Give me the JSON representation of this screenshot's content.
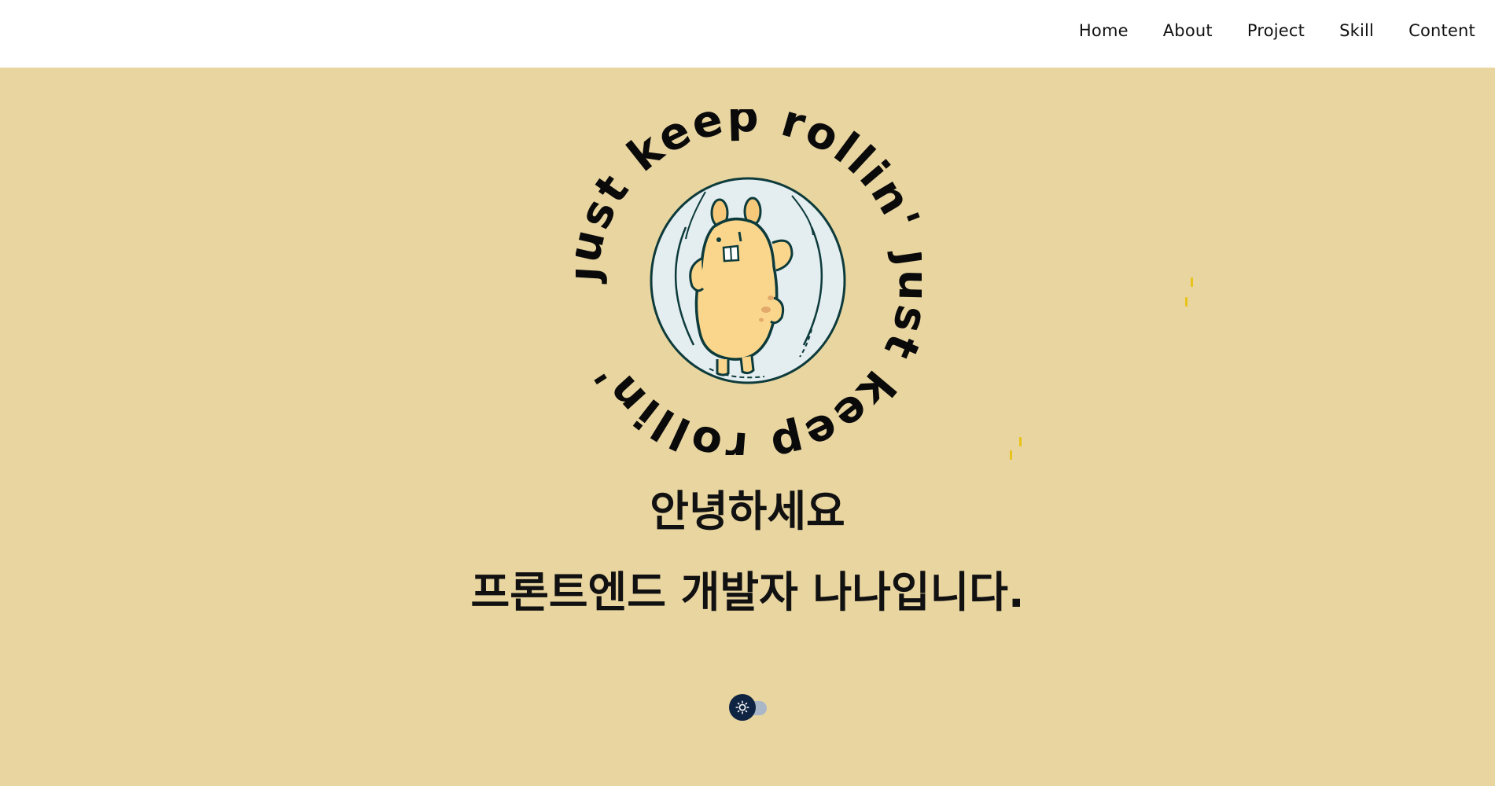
{
  "nav": {
    "items": [
      {
        "label": "Home"
      },
      {
        "label": "About"
      },
      {
        "label": "Project"
      },
      {
        "label": "Skill"
      },
      {
        "label": "Content"
      }
    ]
  },
  "hero": {
    "logo_ring_text": "just keep rollin' just keep rollin'",
    "greeting": "안녕하세요",
    "intro": "프론트엔드 개발자 나나입니다."
  },
  "theme_toggle": {
    "icon": "sun-icon",
    "state": "light"
  },
  "colors": {
    "header_bg": "#ffffff",
    "hero_bg": "#e8d5a0",
    "text": "#111111",
    "toggle_knob": "#0f2342",
    "toggle_track": "#a9b7c9",
    "sparkle": "#e8c31a",
    "hamster_body": "#fad68c",
    "ball_fill": "#e4edf0",
    "outline": "#0d3b3b"
  }
}
